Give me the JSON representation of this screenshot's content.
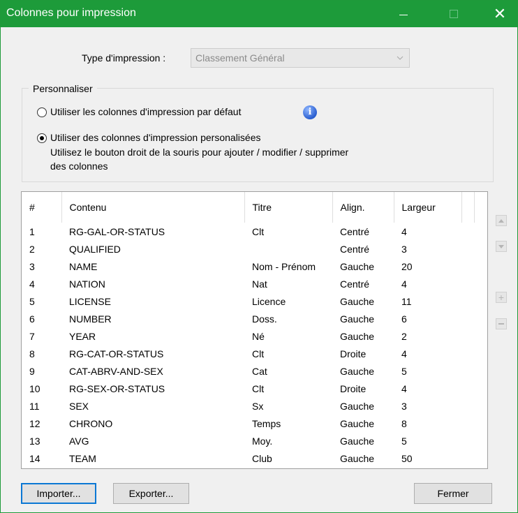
{
  "window": {
    "title": "Colonnes pour impression",
    "close_glyph": "✕"
  },
  "print_type": {
    "label": "Type d'impression :",
    "value": "Classement Général"
  },
  "customize": {
    "legend": "Personnaliser",
    "option_default": "Utiliser les colonnes d'impression par défaut",
    "option_custom": "Utiliser des colonnes d'impression personalisées",
    "help_line1": "Utilisez le bouton droit de la souris pour ajouter / modifier / supprimer",
    "help_line2": "des colonnes",
    "selected": "custom",
    "info_glyph": "i"
  },
  "table": {
    "headers": [
      "#",
      "Contenu",
      "Titre",
      "Align.",
      "Largeur"
    ],
    "rows": [
      [
        "1",
        "RG-GAL-OR-STATUS",
        "Clt",
        "Centré",
        "4"
      ],
      [
        "2",
        "QUALIFIED",
        "",
        "Centré",
        "3"
      ],
      [
        "3",
        "NAME",
        "Nom - Prénom",
        "Gauche",
        "20"
      ],
      [
        "4",
        "NATION",
        "Nat",
        "Centré",
        "4"
      ],
      [
        "5",
        "LICENSE",
        "Licence",
        "Gauche",
        "11"
      ],
      [
        "6",
        "NUMBER",
        "Doss.",
        "Gauche",
        "6"
      ],
      [
        "7",
        "YEAR",
        "Né",
        "Gauche",
        "2"
      ],
      [
        "8",
        "RG-CAT-OR-STATUS",
        "Clt",
        "Droite",
        "4"
      ],
      [
        "9",
        "CAT-ABRV-AND-SEX",
        "Cat",
        "Gauche",
        "5"
      ],
      [
        "10",
        "RG-SEX-OR-STATUS",
        "Clt",
        "Droite",
        "4"
      ],
      [
        "11",
        "SEX",
        "Sx",
        "Gauche",
        "3"
      ],
      [
        "12",
        "CHRONO",
        "Temps",
        "Gauche",
        "8"
      ],
      [
        "13",
        "AVG",
        "Moy.",
        "Gauche",
        "5"
      ],
      [
        "14",
        "TEAM",
        "Club",
        "Gauche",
        "50"
      ]
    ]
  },
  "buttons": {
    "import": "Importer...",
    "export": "Exporter...",
    "close": "Fermer"
  },
  "colors": {
    "titlebar": "#1d9b3a",
    "focus_border": "#0b78d4"
  }
}
